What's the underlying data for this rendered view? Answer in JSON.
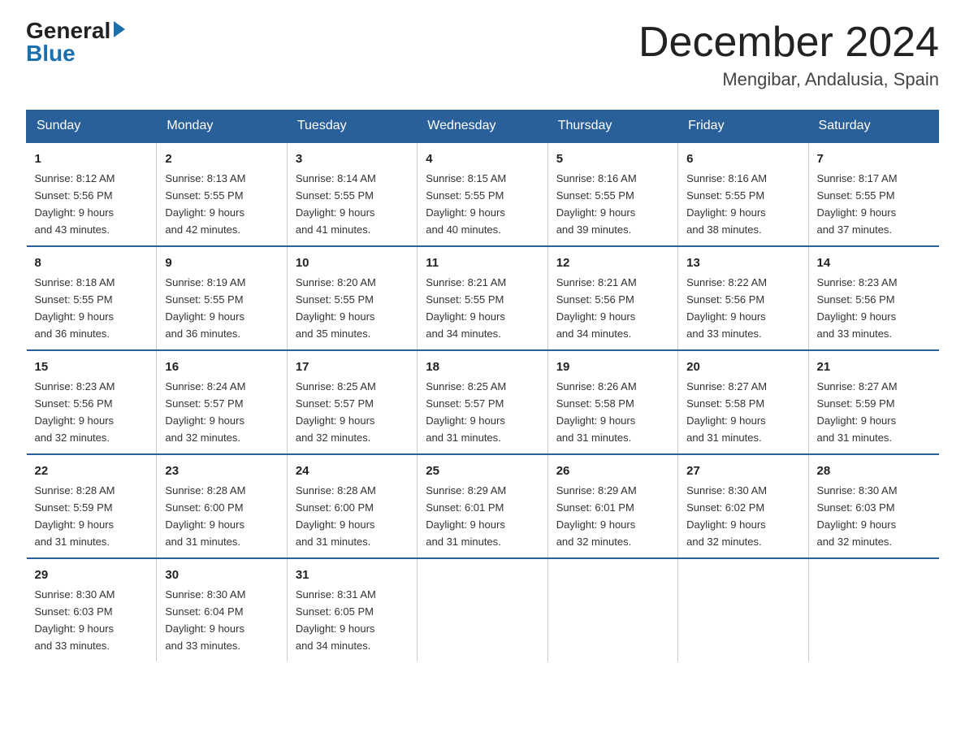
{
  "header": {
    "logo_general": "General",
    "logo_blue": "Blue",
    "month_title": "December 2024",
    "location": "Mengibar, Andalusia, Spain"
  },
  "weekdays": [
    "Sunday",
    "Monday",
    "Tuesday",
    "Wednesday",
    "Thursday",
    "Friday",
    "Saturday"
  ],
  "weeks": [
    [
      {
        "day": "1",
        "sunrise": "8:12 AM",
        "sunset": "5:56 PM",
        "daylight": "9 hours and 43 minutes."
      },
      {
        "day": "2",
        "sunrise": "8:13 AM",
        "sunset": "5:55 PM",
        "daylight": "9 hours and 42 minutes."
      },
      {
        "day": "3",
        "sunrise": "8:14 AM",
        "sunset": "5:55 PM",
        "daylight": "9 hours and 41 minutes."
      },
      {
        "day": "4",
        "sunrise": "8:15 AM",
        "sunset": "5:55 PM",
        "daylight": "9 hours and 40 minutes."
      },
      {
        "day": "5",
        "sunrise": "8:16 AM",
        "sunset": "5:55 PM",
        "daylight": "9 hours and 39 minutes."
      },
      {
        "day": "6",
        "sunrise": "8:16 AM",
        "sunset": "5:55 PM",
        "daylight": "9 hours and 38 minutes."
      },
      {
        "day": "7",
        "sunrise": "8:17 AM",
        "sunset": "5:55 PM",
        "daylight": "9 hours and 37 minutes."
      }
    ],
    [
      {
        "day": "8",
        "sunrise": "8:18 AM",
        "sunset": "5:55 PM",
        "daylight": "9 hours and 36 minutes."
      },
      {
        "day": "9",
        "sunrise": "8:19 AM",
        "sunset": "5:55 PM",
        "daylight": "9 hours and 36 minutes."
      },
      {
        "day": "10",
        "sunrise": "8:20 AM",
        "sunset": "5:55 PM",
        "daylight": "9 hours and 35 minutes."
      },
      {
        "day": "11",
        "sunrise": "8:21 AM",
        "sunset": "5:55 PM",
        "daylight": "9 hours and 34 minutes."
      },
      {
        "day": "12",
        "sunrise": "8:21 AM",
        "sunset": "5:56 PM",
        "daylight": "9 hours and 34 minutes."
      },
      {
        "day": "13",
        "sunrise": "8:22 AM",
        "sunset": "5:56 PM",
        "daylight": "9 hours and 33 minutes."
      },
      {
        "day": "14",
        "sunrise": "8:23 AM",
        "sunset": "5:56 PM",
        "daylight": "9 hours and 33 minutes."
      }
    ],
    [
      {
        "day": "15",
        "sunrise": "8:23 AM",
        "sunset": "5:56 PM",
        "daylight": "9 hours and 32 minutes."
      },
      {
        "day": "16",
        "sunrise": "8:24 AM",
        "sunset": "5:57 PM",
        "daylight": "9 hours and 32 minutes."
      },
      {
        "day": "17",
        "sunrise": "8:25 AM",
        "sunset": "5:57 PM",
        "daylight": "9 hours and 32 minutes."
      },
      {
        "day": "18",
        "sunrise": "8:25 AM",
        "sunset": "5:57 PM",
        "daylight": "9 hours and 31 minutes."
      },
      {
        "day": "19",
        "sunrise": "8:26 AM",
        "sunset": "5:58 PM",
        "daylight": "9 hours and 31 minutes."
      },
      {
        "day": "20",
        "sunrise": "8:27 AM",
        "sunset": "5:58 PM",
        "daylight": "9 hours and 31 minutes."
      },
      {
        "day": "21",
        "sunrise": "8:27 AM",
        "sunset": "5:59 PM",
        "daylight": "9 hours and 31 minutes."
      }
    ],
    [
      {
        "day": "22",
        "sunrise": "8:28 AM",
        "sunset": "5:59 PM",
        "daylight": "9 hours and 31 minutes."
      },
      {
        "day": "23",
        "sunrise": "8:28 AM",
        "sunset": "6:00 PM",
        "daylight": "9 hours and 31 minutes."
      },
      {
        "day": "24",
        "sunrise": "8:28 AM",
        "sunset": "6:00 PM",
        "daylight": "9 hours and 31 minutes."
      },
      {
        "day": "25",
        "sunrise": "8:29 AM",
        "sunset": "6:01 PM",
        "daylight": "9 hours and 31 minutes."
      },
      {
        "day": "26",
        "sunrise": "8:29 AM",
        "sunset": "6:01 PM",
        "daylight": "9 hours and 32 minutes."
      },
      {
        "day": "27",
        "sunrise": "8:30 AM",
        "sunset": "6:02 PM",
        "daylight": "9 hours and 32 minutes."
      },
      {
        "day": "28",
        "sunrise": "8:30 AM",
        "sunset": "6:03 PM",
        "daylight": "9 hours and 32 minutes."
      }
    ],
    [
      {
        "day": "29",
        "sunrise": "8:30 AM",
        "sunset": "6:03 PM",
        "daylight": "9 hours and 33 minutes."
      },
      {
        "day": "30",
        "sunrise": "8:30 AM",
        "sunset": "6:04 PM",
        "daylight": "9 hours and 33 minutes."
      },
      {
        "day": "31",
        "sunrise": "8:31 AM",
        "sunset": "6:05 PM",
        "daylight": "9 hours and 34 minutes."
      },
      null,
      null,
      null,
      null
    ]
  ],
  "labels": {
    "sunrise": "Sunrise:",
    "sunset": "Sunset:",
    "daylight": "Daylight:"
  }
}
